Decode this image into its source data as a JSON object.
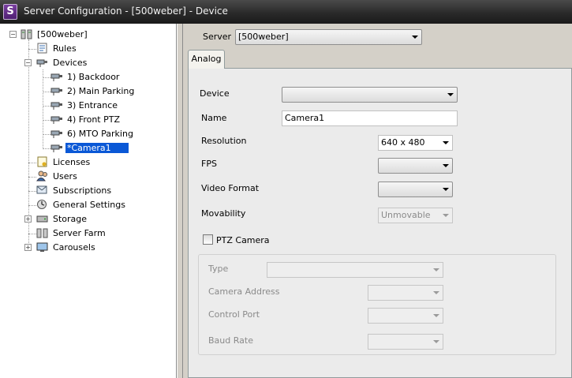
{
  "window": {
    "title": "Server Configuration - [500weber] - Device",
    "icon_letter": "S"
  },
  "tree": {
    "root": "[500weber]",
    "items": [
      {
        "label": "Rules",
        "icon": "rules-icon"
      },
      {
        "label": "Devices",
        "icon": "devices-icon"
      },
      {
        "label": "1) Backdoor",
        "icon": "camera-icon"
      },
      {
        "label": "2) Main Parking",
        "icon": "camera-icon"
      },
      {
        "label": "3) Entrance",
        "icon": "camera-icon"
      },
      {
        "label": "4) Front PTZ",
        "icon": "camera-icon"
      },
      {
        "label": "6) MTO Parking",
        "icon": "camera-icon"
      },
      {
        "label": "*Camera1",
        "icon": "camera-icon",
        "selected": true
      },
      {
        "label": "Licenses",
        "icon": "licenses-icon"
      },
      {
        "label": "Users",
        "icon": "users-icon"
      },
      {
        "label": "Subscriptions",
        "icon": "subscriptions-icon"
      },
      {
        "label": "General Settings",
        "icon": "settings-icon"
      },
      {
        "label": "Storage",
        "icon": "storage-icon"
      },
      {
        "label": "Server Farm",
        "icon": "server-farm-icon"
      },
      {
        "label": "Carousels",
        "icon": "carousels-icon"
      }
    ]
  },
  "server": {
    "label": "Server",
    "value": "[500weber]"
  },
  "tabs": [
    {
      "label": "Analog"
    }
  ],
  "form": {
    "device": {
      "label": "Device",
      "value": ""
    },
    "name": {
      "label": "Name",
      "value": "Camera1"
    },
    "resolution": {
      "label": "Resolution",
      "value": "640 x 480"
    },
    "fps": {
      "label": "FPS",
      "value": ""
    },
    "video_format": {
      "label": "Video Format",
      "value": ""
    },
    "movability": {
      "label": "Movability",
      "value": "Unmovable"
    },
    "ptz_camera": {
      "label": "PTZ Camera",
      "checked": false
    }
  },
  "ptz": {
    "type": {
      "label": "Type",
      "value": ""
    },
    "camera_address": {
      "label": "Camera Address",
      "value": ""
    },
    "control_port": {
      "label": "Control Port",
      "value": ""
    },
    "baud_rate": {
      "label": "Baud Rate",
      "value": ""
    }
  }
}
